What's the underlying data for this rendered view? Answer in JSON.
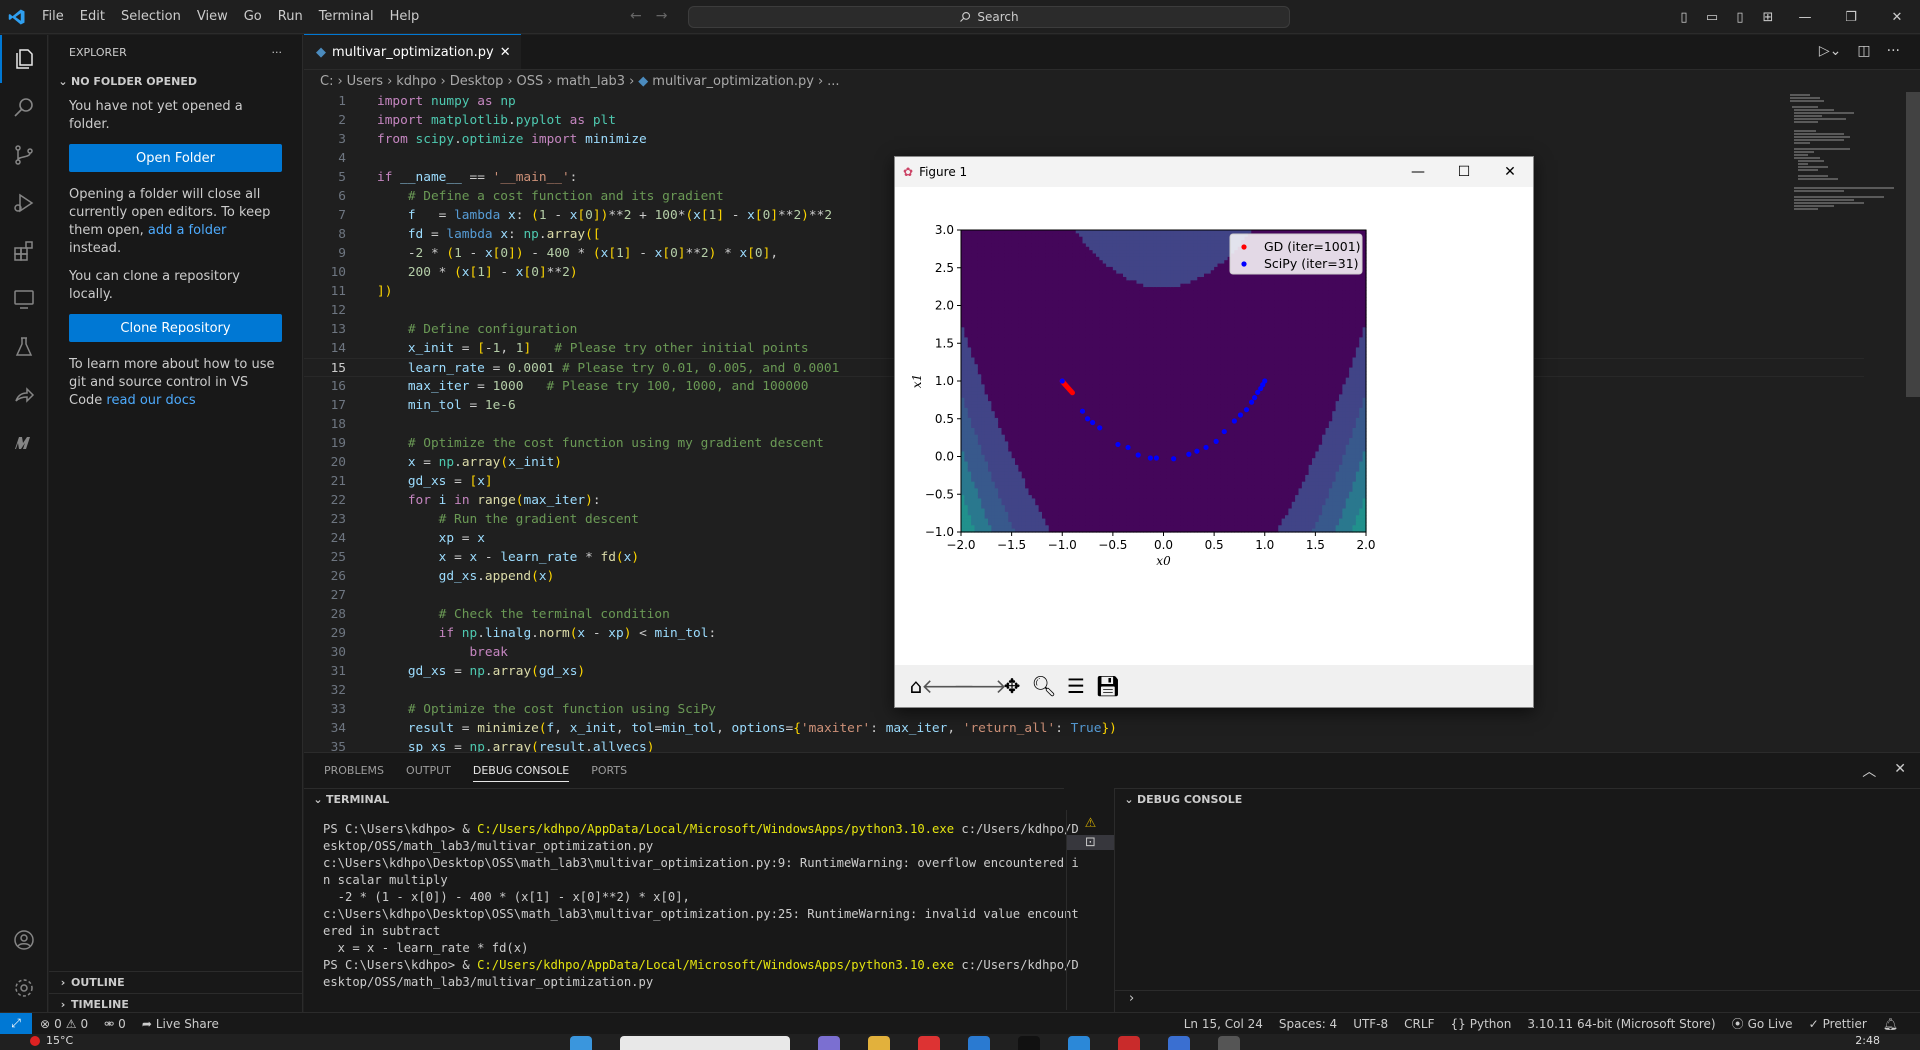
{
  "menu": [
    "File",
    "Edit",
    "Selection",
    "View",
    "Go",
    "Run",
    "Terminal",
    "Help"
  ],
  "search": {
    "placeholder": "Search"
  },
  "explorer": {
    "title": "EXPLORER",
    "section": "NO FOLDER OPENED",
    "msg1": "You have not yet opened a folder.",
    "open_folder": "Open Folder",
    "msg2a": "Opening a folder will close all currently open editors. To keep them open,",
    "msg2_link": "add a folder",
    "msg2b": "instead.",
    "msg3": "You can clone a repository locally.",
    "clone": "Clone Repository",
    "msg4a": "To learn more about how to use git and source control in VS Code",
    "msg4_link": "read our docs",
    "outline": "OUTLINE",
    "timeline": "TIMELINE"
  },
  "tab": {
    "label": "multivar_optimization.py"
  },
  "breadcrumb": [
    "C:",
    "Users",
    "kdhpo",
    "Desktop",
    "OSS",
    "math_lab3",
    "multivar_optimization.py",
    "..."
  ],
  "code": [
    "import numpy as np",
    "import matplotlib.pyplot as plt",
    "from scipy.optimize import minimize",
    "",
    "if __name__ == '__main__':",
    "    # Define a cost function and its gradient",
    "    f   = lambda x: (1 - x[0])**2 + 100*(x[1] - x[0]**2)**2",
    "    fd = lambda x: np.array([",
    "    -2 * (1 - x[0]) - 400 * (x[1] - x[0]**2) * x[0],",
    "    200 * (x[1] - x[0]**2)",
    "])",
    "",
    "    # Define configuration",
    "    x_init = [-1, 1]   # Please try other initial points",
    "    learn_rate = 0.0001 # Please try 0.01, 0.005, and 0.0001",
    "    max_iter = 1000   # Please try 100, 1000, and 100000",
    "    min_tol = 1e-6",
    "",
    "    # Optimize the cost function using my gradient descent",
    "    x = np.array(x_init)",
    "    gd_xs = [x]",
    "    for i in range(max_iter):",
    "        # Run the gradient descent",
    "        xp = x",
    "        x = x - learn_rate * fd(x)",
    "        gd_xs.append(x)",
    "",
    "        # Check the terminal condition",
    "        if np.linalg.norm(x - xp) < min_tol:",
    "            break",
    "    gd_xs = np.array(gd_xs)",
    "",
    "    # Optimize the cost function using SciPy",
    "    result = minimize(f, x_init, tol=min_tol, options={'maxiter': max_iter, 'return_all': True})",
    "    sp_xs = np.array(result.allvecs)"
  ],
  "current_line": 15,
  "figure": {
    "title": "Figure 1"
  },
  "chart_data": {
    "type": "scatter",
    "title": "",
    "xlabel": "x0",
    "ylabel": "x1",
    "xlim": [
      -2.0,
      2.0
    ],
    "ylim": [
      -1.0,
      3.0
    ],
    "xticks": [
      "−2.0",
      "−1.5",
      "−1.0",
      "−0.5",
      "0.0",
      "0.5",
      "1.0",
      "1.5",
      "2.0"
    ],
    "yticks": [
      "−1.0",
      "−0.5",
      "0.0",
      "0.5",
      "1.0",
      "1.5",
      "2.0",
      "2.5",
      "3.0"
    ],
    "legend_position": "top-right",
    "series": [
      {
        "name": "GD (iter=1001)",
        "color": "#ff0000",
        "x": [
          -1.0,
          -0.99,
          -0.98,
          -0.97,
          -0.96,
          -0.95,
          -0.94,
          -0.93,
          -0.92,
          -0.91,
          -0.9
        ],
        "y": [
          1.0,
          0.98,
          0.965,
          0.95,
          0.935,
          0.92,
          0.905,
          0.89,
          0.875,
          0.86,
          0.845
        ]
      },
      {
        "name": "SciPy (iter=31)",
        "color": "#0000ff",
        "x": [
          -1.0,
          -0.8,
          -0.75,
          -0.7,
          -0.63,
          -0.45,
          -0.35,
          -0.25,
          -0.13,
          -0.07,
          0.1,
          0.25,
          0.33,
          0.42,
          0.52,
          0.6,
          0.7,
          0.76,
          0.82,
          0.87,
          0.9,
          0.93,
          0.96,
          0.98,
          1.0
        ],
        "y": [
          1.0,
          0.6,
          0.5,
          0.45,
          0.38,
          0.16,
          0.12,
          0.02,
          -0.02,
          -0.02,
          -0.03,
          0.03,
          0.07,
          0.12,
          0.2,
          0.33,
          0.47,
          0.55,
          0.62,
          0.72,
          0.78,
          0.85,
          0.9,
          0.95,
          1.0
        ]
      }
    ]
  },
  "panel": {
    "tabs": [
      "PROBLEMS",
      "OUTPUT",
      "DEBUG CONSOLE",
      "PORTS"
    ],
    "active": "DEBUG CONSOLE",
    "terminal_title": "TERMINAL",
    "debug_title": "DEBUG CONSOLE",
    "terminal_lines": [
      {
        "p": "PS C:\\Users\\kdhpo> & ",
        "y": "C:/Users/kdhpo/AppData/Local/Microsoft/WindowsApps/python3.10.exe",
        "r": " c:/Users/kdhpo/D"
      },
      {
        "p": "esktop/OSS/math_lab3/multivar_optimization.py",
        "y": "",
        "r": ""
      },
      {
        "p": "c:\\Users\\kdhpo\\Desktop\\OSS\\math_lab3\\multivar_optimization.py:9: RuntimeWarning: overflow encountered i",
        "y": "",
        "r": ""
      },
      {
        "p": "n scalar multiply",
        "y": "",
        "r": ""
      },
      {
        "p": "  -2 * (1 - x[0]) - 400 * (x[1] - x[0]**2) * x[0],",
        "y": "",
        "r": ""
      },
      {
        "p": "c:\\Users\\kdhpo\\Desktop\\OSS\\math_lab3\\multivar_optimization.py:25: RuntimeWarning: invalid value encount",
        "y": "",
        "r": ""
      },
      {
        "p": "ered in subtract",
        "y": "",
        "r": ""
      },
      {
        "p": "  x = x - learn_rate * fd(x)",
        "y": "",
        "r": ""
      },
      {
        "p": "PS C:\\Users\\kdhpo> & ",
        "y": "C:/Users/kdhpo/AppData/Local/Microsoft/WindowsApps/python3.10.exe",
        "r": " c:/Users/kdhpo/D"
      },
      {
        "p": "esktop/OSS/math_lab3/multivar_optimization.py",
        "y": "",
        "r": ""
      }
    ]
  },
  "status": {
    "errors": "0",
    "warnings": "0",
    "ports": "0",
    "live_share": "Live Share",
    "position": "Ln 15, Col 24",
    "spaces": "Spaces: 4",
    "encoding": "UTF-8",
    "eol": "CRLF",
    "language": "Python",
    "interpreter": "3.10.11 64-bit (Microsoft Store)",
    "golive": "Go Live",
    "prettier": "Prettier"
  },
  "taskbar": {
    "weather": "15°C",
    "time": "2:48"
  }
}
